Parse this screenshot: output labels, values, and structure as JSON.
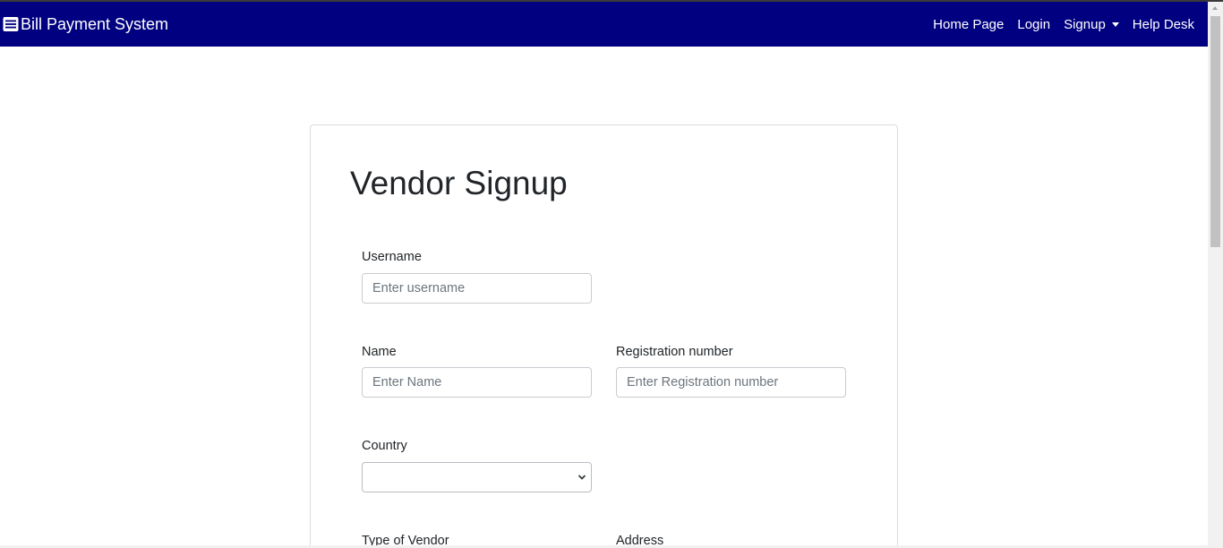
{
  "navbar": {
    "brand_icon": "list-menu-icon",
    "brand": "Bill Payment System",
    "links": {
      "home": "Home Page",
      "login": "Login",
      "signup": "Signup",
      "help": "Help Desk"
    },
    "colors": {
      "background": "#000080",
      "text": "#ffffff"
    }
  },
  "form": {
    "title": "Vendor Signup",
    "username": {
      "label": "Username",
      "placeholder": "Enter username",
      "value": ""
    },
    "name": {
      "label": "Name",
      "placeholder": "Enter Name",
      "value": ""
    },
    "registration_number": {
      "label": "Registration number",
      "placeholder": "Enter Registration number",
      "value": ""
    },
    "country": {
      "label": "Country",
      "selected": ""
    },
    "type_of_vendor": {
      "label": "Type of Vendor"
    },
    "address": {
      "label": "Address"
    }
  }
}
